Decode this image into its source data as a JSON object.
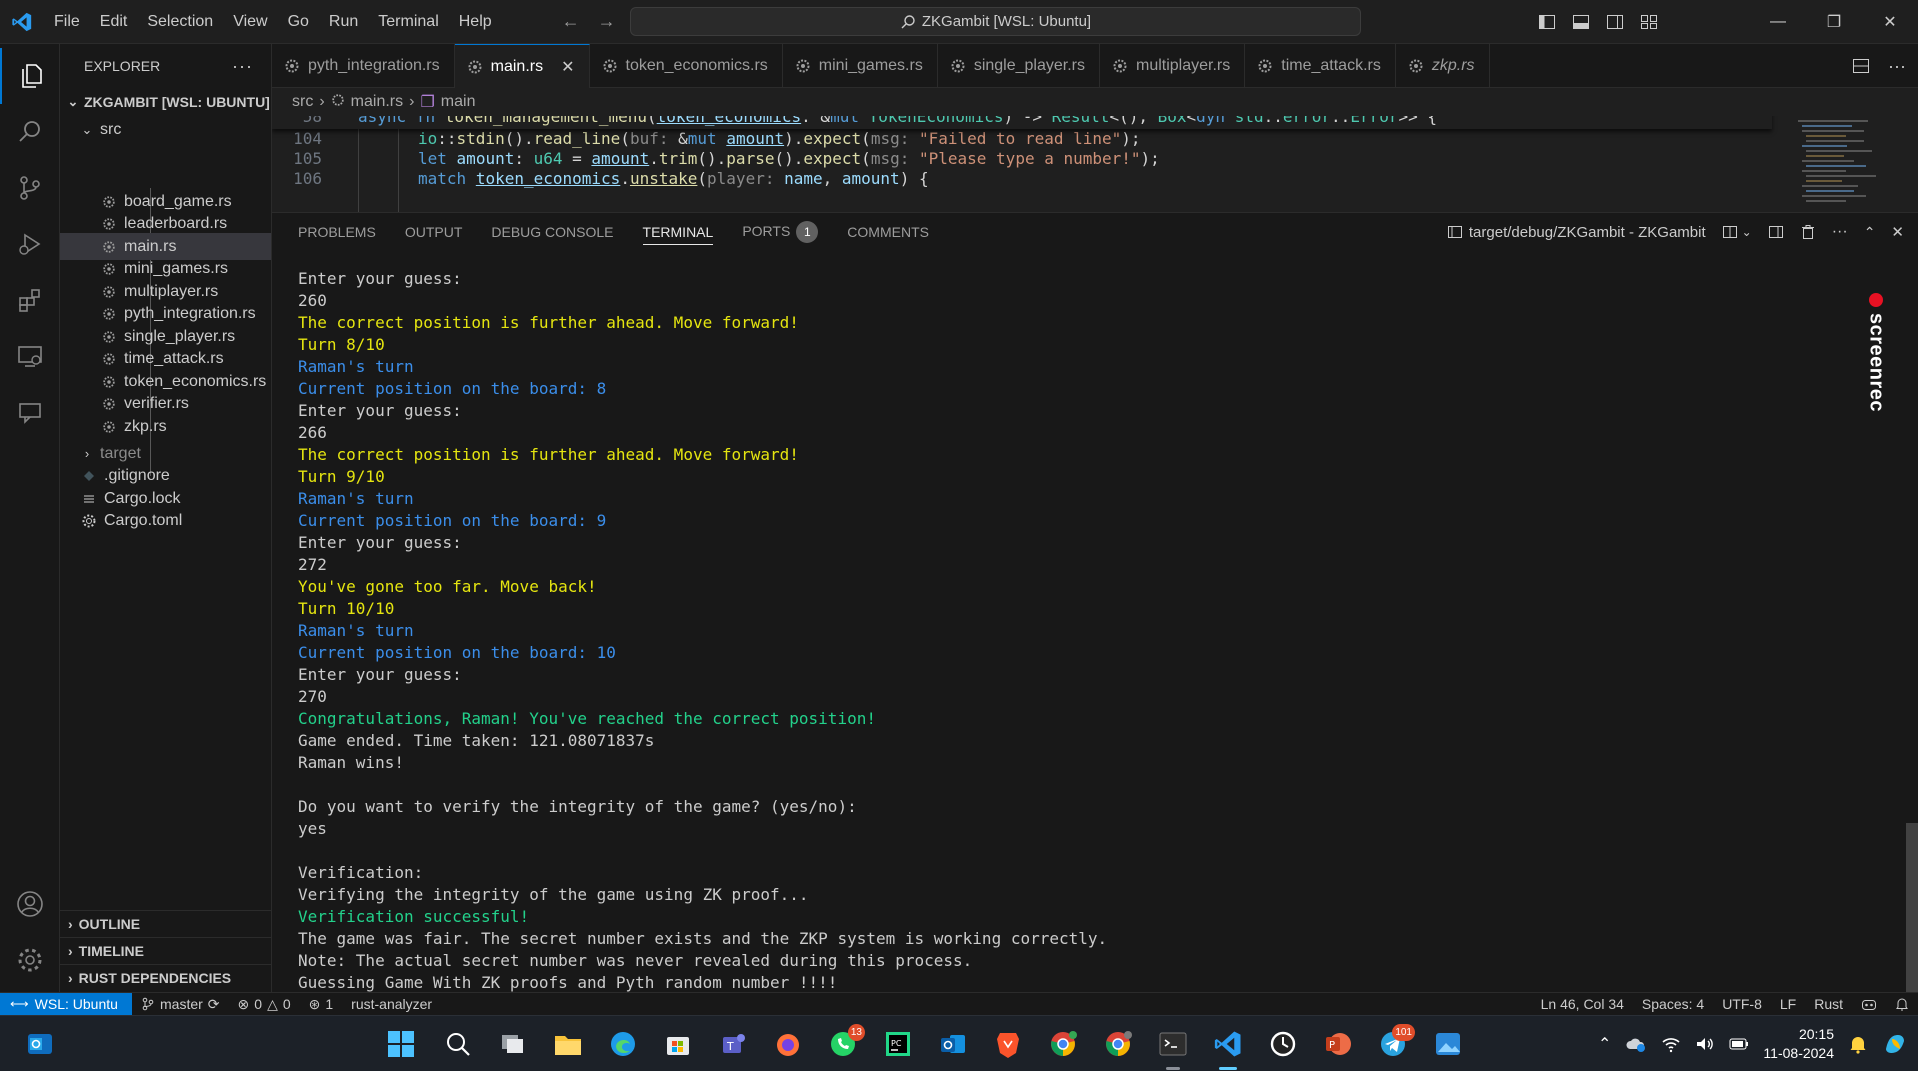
{
  "window": {
    "title": "ZKGambit [WSL: Ubuntu]",
    "menu": [
      "File",
      "Edit",
      "Selection",
      "View",
      "Go",
      "Run",
      "Terminal",
      "Help"
    ]
  },
  "explorer": {
    "header": "EXPLORER",
    "root": "ZKGAMBIT [WSL: UBUNTU]",
    "src_folder": "src",
    "src_files": [
      "board_game.rs",
      "leaderboard.rs",
      "main.rs",
      "mini_games.rs",
      "multiplayer.rs",
      "pyth_integration.rs",
      "single_player.rs",
      "time_attack.rs",
      "token_economics.rs",
      "verifier.rs",
      "zkp.rs"
    ],
    "selected": "main.rs",
    "target_folder": "target",
    "root_files": [
      ".gitignore",
      "Cargo.lock",
      "Cargo.toml"
    ],
    "sections": [
      "OUTLINE",
      "TIMELINE",
      "RUST DEPENDENCIES"
    ]
  },
  "tabs": [
    {
      "label": "pyth_integration.rs",
      "active": false
    },
    {
      "label": "main.rs",
      "active": true
    },
    {
      "label": "token_economics.rs",
      "active": false
    },
    {
      "label": "mini_games.rs",
      "active": false
    },
    {
      "label": "single_player.rs",
      "active": false
    },
    {
      "label": "multiplayer.rs",
      "active": false
    },
    {
      "label": "time_attack.rs",
      "active": false
    },
    {
      "label": "zkp.rs",
      "active": false
    }
  ],
  "breadcrumb": {
    "folder": "src",
    "file": "main.rs",
    "symbol": "main"
  },
  "editor": {
    "line_numbers": [
      "58",
      "104",
      "105",
      "106"
    ]
  },
  "panel": {
    "tabs": [
      "PROBLEMS",
      "OUTPUT",
      "DEBUG CONSOLE",
      "TERMINAL",
      "PORTS",
      "COMMENTS"
    ],
    "active_tab": "TERMINAL",
    "ports_badge": "1",
    "terminal_title": "target/debug/ZKGambit - ZKGambit",
    "terminal_lines": [
      {
        "text": "Enter your guess:",
        "color": "default"
      },
      {
        "text": "260",
        "color": "default"
      },
      {
        "text": "The correct position is further ahead. Move forward!",
        "color": "yellow"
      },
      {
        "text": "Turn 8/10",
        "color": "yellow"
      },
      {
        "text": "Raman's turn",
        "color": "blue"
      },
      {
        "text": "Current position on the board: 8",
        "color": "blue"
      },
      {
        "text": "Enter your guess:",
        "color": "default"
      },
      {
        "text": "266",
        "color": "default"
      },
      {
        "text": "The correct position is further ahead. Move forward!",
        "color": "yellow"
      },
      {
        "text": "Turn 9/10",
        "color": "yellow"
      },
      {
        "text": "Raman's turn",
        "color": "blue"
      },
      {
        "text": "Current position on the board: 9",
        "color": "blue"
      },
      {
        "text": "Enter your guess:",
        "color": "default"
      },
      {
        "text": "272",
        "color": "default"
      },
      {
        "text": "You've gone too far. Move back!",
        "color": "yellow"
      },
      {
        "text": "Turn 10/10",
        "color": "yellow"
      },
      {
        "text": "Raman's turn",
        "color": "blue"
      },
      {
        "text": "Current position on the board: 10",
        "color": "blue"
      },
      {
        "text": "Enter your guess:",
        "color": "default"
      },
      {
        "text": "270",
        "color": "default"
      },
      {
        "text": "Congratulations, Raman! You've reached the correct position!",
        "color": "green"
      },
      {
        "text": "Game ended. Time taken: 121.08071837s",
        "color": "default"
      },
      {
        "text": "Raman wins!",
        "color": "default"
      },
      {
        "text": "",
        "color": "blank"
      },
      {
        "text": "Do you want to verify the integrity of the game? (yes/no):",
        "color": "default"
      },
      {
        "text": "yes",
        "color": "default"
      },
      {
        "text": "",
        "color": "blank"
      },
      {
        "text": "Verification:",
        "color": "default"
      },
      {
        "text": "Verifying the integrity of the game using ZK proof...",
        "color": "default"
      },
      {
        "text": "Verification successful!",
        "color": "green"
      },
      {
        "text": "The game was fair. The secret number exists and the ZKP system is working correctly.",
        "color": "default"
      },
      {
        "text": "Note: The actual secret number was never revealed during this process.",
        "color": "default"
      },
      {
        "text": "Guessing Game With ZK proofs and Pyth random number !!!!",
        "color": "default"
      }
    ],
    "watermark": "screenrec"
  },
  "statusbar": {
    "remote": "WSL: Ubuntu",
    "branch": "master",
    "errors": "0",
    "warnings": "0",
    "ports": "1",
    "analyzer": "rust-analyzer",
    "position": "Ln 46, Col 34",
    "spaces": "Spaces: 4",
    "encoding": "UTF-8",
    "eol": "LF",
    "language": "Rust"
  },
  "taskbar": {
    "whatsapp_badge": "13",
    "telegram_badge": "101",
    "time": "20:15",
    "date": "11-08-2024"
  },
  "colors": {
    "accent": "#0078d4",
    "terminal_yellow": "#e5e510",
    "terminal_blue": "#3b8eea",
    "terminal_green": "#23d18b"
  }
}
